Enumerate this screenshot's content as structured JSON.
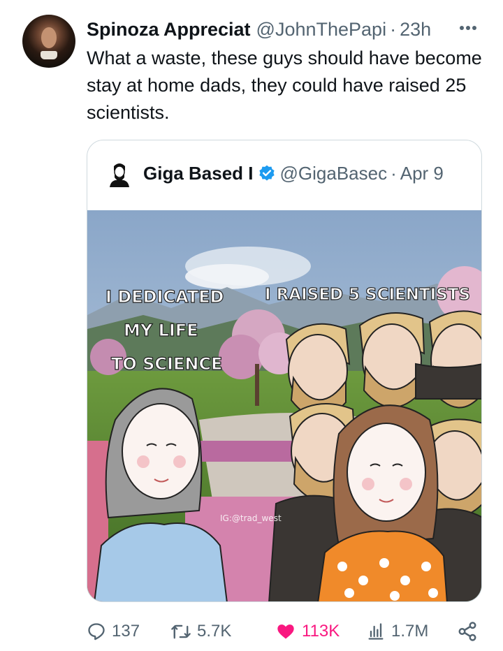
{
  "tweet": {
    "author_name": "Spinoza Appreciat",
    "handle": "@JohnThePapi",
    "separator": "·",
    "time": "23h",
    "text": "What a waste, these guys should have become stay at home dads, they could have raised 25 scientists."
  },
  "quoted_tweet": {
    "author_name": "Giga Based I",
    "handle": "@GigaBasec",
    "separator": "·",
    "date": "Apr 9",
    "meme": {
      "left_caption": [
        "I DEDICATED",
        "MY LIFE",
        "TO SCIENCE"
      ],
      "right_caption": "I RAISED 5 SCIENTISTS",
      "watermark": "IG:@trad_west"
    }
  },
  "actions": {
    "replies": "137",
    "retweets": "5.7K",
    "likes": "113K",
    "views": "1.7M"
  },
  "colors": {
    "text": "#0f1419",
    "secondary": "#536471",
    "like": "#f91880",
    "verified": "#1d9bf0",
    "border": "#cfd9de"
  }
}
